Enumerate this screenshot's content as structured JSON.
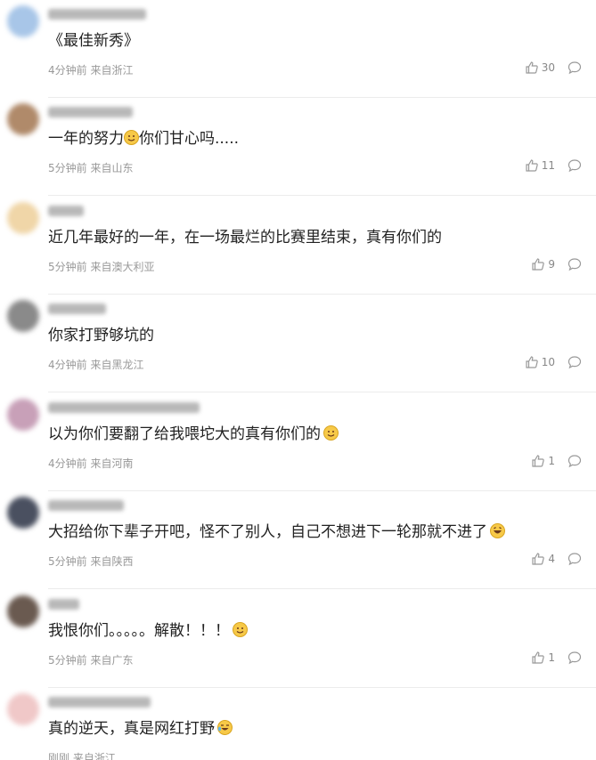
{
  "comments": [
    {
      "text": "《最佳新秀》",
      "time": "4分钟前",
      "location": "来自浙江",
      "likes": "30",
      "avatar_color": "#a8c6e8",
      "emoji": "",
      "emoji_after": false
    },
    {
      "text": "一年的努力",
      "text_after": "你们甘心吗.....",
      "time": "5分钟前",
      "location": "来自山东",
      "likes": "11",
      "avatar_color": "#b08a6a",
      "emoji": "smile-emoji",
      "emoji_after": false
    },
    {
      "text": "近几年最好的一年，在一场最烂的比赛里结束，真有你们的",
      "time": "5分钟前",
      "location": "来自澳大利亚",
      "likes": "9",
      "avatar_color": "#f0d6a8",
      "emoji": "",
      "emoji_after": false
    },
    {
      "text": "你家打野够坑的",
      "time": "4分钟前",
      "location": "来自黑龙江",
      "likes": "10",
      "avatar_color": "#8a8a8a",
      "emoji": "",
      "emoji_after": false
    },
    {
      "text": "以为你们要翻了给我喂坨大的真有你们的",
      "time": "4分钟前",
      "location": "来自河南",
      "likes": "1",
      "avatar_color": "#c8a0b8",
      "emoji": "smile-emoji",
      "emoji_after": true
    },
    {
      "text": "大招给你下辈子开吧，怪不了别人，自己不想进下一轮那就不进了",
      "time": "5分钟前",
      "location": "来自陕西",
      "likes": "4",
      "avatar_color": "#4a5060",
      "emoji": "laugh-emoji",
      "emoji_after": true
    },
    {
      "text": "我恨你们。。。。。解散！！！",
      "time": "5分钟前",
      "location": "来自广东",
      "likes": "1",
      "avatar_color": "#6a5a50",
      "emoji": "smile-emoji",
      "emoji_after": true
    },
    {
      "text": "真的逆天，真是网红打野",
      "time": "刚刚",
      "location": "来自浙江",
      "likes": "",
      "avatar_color": "#f0c8c8",
      "emoji": "laugh-cry-emoji",
      "emoji_after": true
    }
  ]
}
